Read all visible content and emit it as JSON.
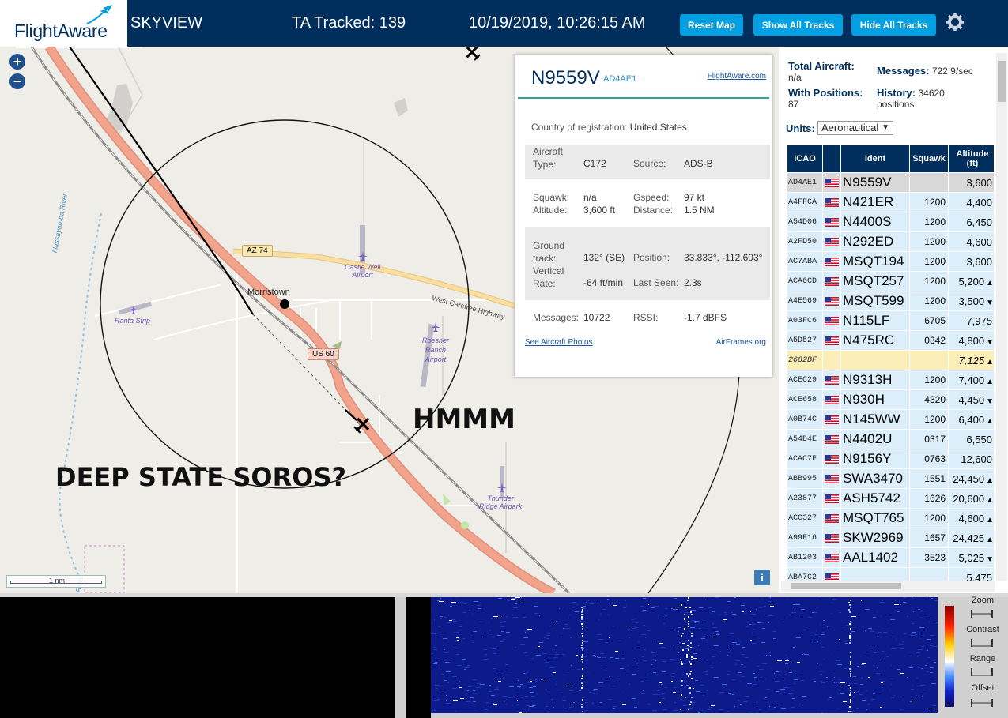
{
  "header": {
    "brand": "FlightAware",
    "site_name": "SKYVIEW",
    "tracked": "TA Tracked: 139",
    "datetime": "10/19/2019, 10:26:15 AM",
    "buttons": {
      "reset": "Reset Map",
      "show_all": "Show All Tracks",
      "hide_all": "Hide All Tracks"
    }
  },
  "map": {
    "labels": {
      "az74": "AZ 74",
      "us60": "US 60",
      "morristown": "Morristown",
      "castle_well_1": "Castle Well",
      "castle_well_2": "Airport",
      "ranta": "Ranta Strip",
      "roesner_1": "Roesner",
      "roesner_2": "Ranch",
      "roesner_3": "Airport",
      "thunder_1": "Thunder",
      "thunder_2": "Ridge Airpark",
      "highway": "West Carefree Highway",
      "river_1": "Hassayampa River",
      "river_2": "River"
    },
    "annotations": {
      "hmmm": "HMMM",
      "deep_state": "DEEP STATE SOROS?"
    },
    "scale": "1 nm",
    "zoom_in": "+",
    "zoom_out": "−",
    "info": "i"
  },
  "popup": {
    "callsign": "N9559V",
    "hex": "AD4AE1",
    "fa_link": "FlightAware.com",
    "country_label": "Country of registration:",
    "country": "United States",
    "aircraft_type_label_1": "Aircraft",
    "aircraft_type_label_2": "Type:",
    "aircraft_type": "C172",
    "source_label": "Source:",
    "source": "ADS-B",
    "squawk_label": "Squawk:",
    "squawk": "n/a",
    "altitude_label": "Altitude:",
    "altitude": "3,600 ft",
    "gspeed_label": "Gspeed:",
    "gspeed": "97 kt",
    "distance_label": "Distance:",
    "distance": "1.5 NM",
    "ground_label_1": "Ground",
    "ground_label_2": "track:",
    "ground_track": "132° (SE)",
    "position_label": "Position:",
    "position": "33.833°, -112.603°",
    "vrate_label_1": "Vertical",
    "vrate_label_2": "Rate:",
    "vertical_rate": "-64 ft/min",
    "last_seen_label": "Last Seen:",
    "last_seen": "2.3s",
    "messages_label": "Messages:",
    "messages": "10722",
    "rssi_label": "RSSI:",
    "rssi": "-1.7 dBFS",
    "photos_link": "See Aircraft Photos",
    "airframes_link": "AirFrames.org"
  },
  "panel": {
    "total_label": "Total Aircraft:",
    "total": "n/a",
    "messages_label": "Messages:",
    "messages": "722.9/sec",
    "with_pos_label": "With Positions:",
    "with_pos": "87",
    "history_label": "History:",
    "history": "34620",
    "history_unit": "positions",
    "units_label": "Units:",
    "units_value": "Aeronautical",
    "columns": {
      "icao": "ICAO",
      "ident": "Ident",
      "squawk": "Squawk",
      "alt_1": "Altitude",
      "alt_2": "(ft)"
    }
  },
  "aircraft": [
    {
      "icao": "AD4AE1",
      "ident": "N9559V",
      "squawk": "",
      "alt": "3,600",
      "trend": ""
    },
    {
      "icao": "A4FFCA",
      "ident": "N421ER",
      "squawk": "1200",
      "alt": "4,400",
      "trend": ""
    },
    {
      "icao": "A54D06",
      "ident": "N4400S",
      "squawk": "1200",
      "alt": "6,450",
      "trend": ""
    },
    {
      "icao": "A2FD50",
      "ident": "N292ED",
      "squawk": "1200",
      "alt": "4,600",
      "trend": ""
    },
    {
      "icao": "AC7ABA",
      "ident": "MSQT194",
      "squawk": "1200",
      "alt": "3,600",
      "trend": ""
    },
    {
      "icao": "ACA6CD",
      "ident": "MSQT257",
      "squawk": "1200",
      "alt": "5,200",
      "trend": "▲"
    },
    {
      "icao": "A4E569",
      "ident": "MSQT599",
      "squawk": "1200",
      "alt": "3,500",
      "trend": "▼"
    },
    {
      "icao": "A03FC6",
      "ident": "N115LF",
      "squawk": "6705",
      "alt": "7,975",
      "trend": ""
    },
    {
      "icao": "A5D527",
      "ident": "N475RC",
      "squawk": "0342",
      "alt": "4,800",
      "trend": "▼"
    },
    {
      "icao": "2682BF",
      "ident": "",
      "squawk": "",
      "alt": "7,125",
      "trend": "▲"
    },
    {
      "icao": "ACEC29",
      "ident": "N9313H",
      "squawk": "1200",
      "alt": "7,400",
      "trend": "▲"
    },
    {
      "icao": "ACE658",
      "ident": "N930H",
      "squawk": "4320",
      "alt": "4,450",
      "trend": "▼"
    },
    {
      "icao": "A0B74C",
      "ident": "N145WW",
      "squawk": "1200",
      "alt": "6,400",
      "trend": "▲"
    },
    {
      "icao": "A54D4E",
      "ident": "N4402U",
      "squawk": "0317",
      "alt": "6,550",
      "trend": ""
    },
    {
      "icao": "ACAC7F",
      "ident": "N9156Y",
      "squawk": "0763",
      "alt": "12,600",
      "trend": ""
    },
    {
      "icao": "ABB995",
      "ident": "SWA3470",
      "squawk": "1551",
      "alt": "24,450",
      "trend": "▲"
    },
    {
      "icao": "A23877",
      "ident": "ASH5742",
      "squawk": "1626",
      "alt": "20,600",
      "trend": "▲"
    },
    {
      "icao": "ACC327",
      "ident": "MSQT765",
      "squawk": "1200",
      "alt": "4,600",
      "trend": "▲"
    },
    {
      "icao": "A99F16",
      "ident": "SKW2969",
      "squawk": "1657",
      "alt": "24,425",
      "trend": "▲"
    },
    {
      "icao": "AB1203",
      "ident": "AAL1402",
      "squawk": "3523",
      "alt": "5,025",
      "trend": "▼"
    },
    {
      "icao": "ABA7C2",
      "ident": "",
      "squawk": "",
      "alt": "5,475",
      "trend": ""
    }
  ],
  "waterfall": {
    "zoom": "Zoom",
    "contrast": "Contrast",
    "range": "Range",
    "offset": "Offset"
  },
  "colors": {
    "header_bg": "#002f5d",
    "button": "#00a0e2",
    "road": "#f1a38c",
    "highway": "#f5d7a0"
  },
  "icons": [
    "plus-icon",
    "minus-icon",
    "gear-icon",
    "plane-icon",
    "airport-icon",
    "us-flag-icon",
    "info-icon"
  ]
}
